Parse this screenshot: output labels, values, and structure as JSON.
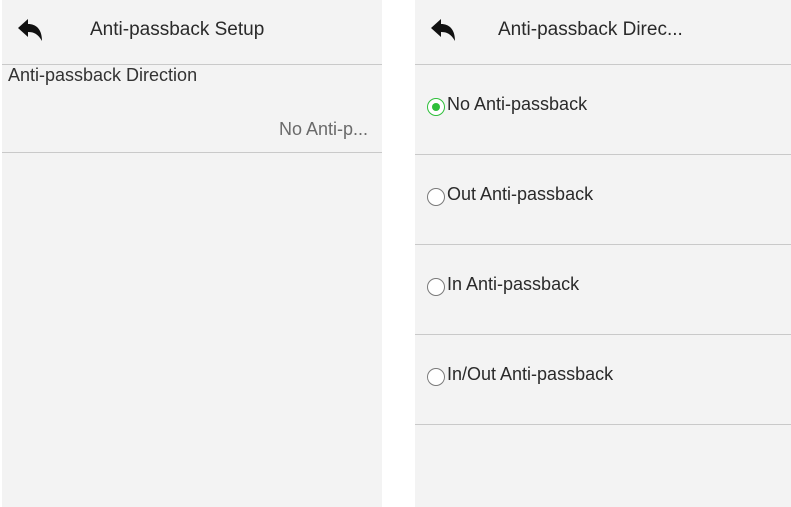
{
  "left_screen": {
    "title": "Anti-passback Setup",
    "back_icon": "back-arrow-icon",
    "setting": {
      "label": "Anti-passback Direction",
      "value": "No Anti-p..."
    }
  },
  "right_screen": {
    "title": "Anti-passback Direc...",
    "back_icon": "back-arrow-icon",
    "accent_color": "#2fbf3b",
    "options": [
      {
        "label": "No Anti-passback",
        "selected": true
      },
      {
        "label": "Out Anti-passback",
        "selected": false
      },
      {
        "label": "In Anti-passback",
        "selected": false
      },
      {
        "label": "In/Out Anti-passback",
        "selected": false
      }
    ]
  }
}
